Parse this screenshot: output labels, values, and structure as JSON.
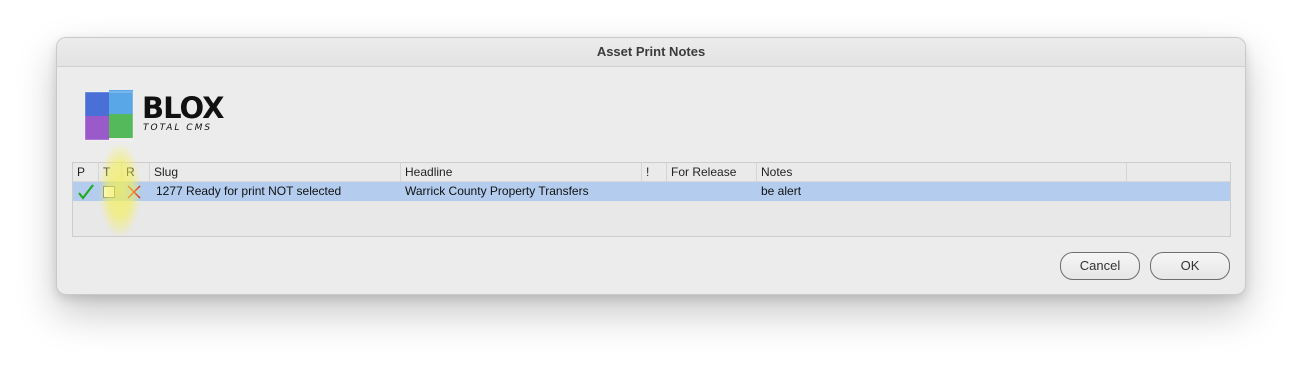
{
  "window": {
    "title": "Asset Print Notes"
  },
  "logo": {
    "word": "BLOX",
    "sub": "TOTAL CMS"
  },
  "table": {
    "columns": [
      "P",
      "T",
      "R",
      "Slug",
      "Headline",
      "!",
      "For Release",
      "Notes"
    ],
    "rows": [
      {
        "p_icon": "green-check-icon",
        "t_icon": "checkbox-icon",
        "r_icon": "red-x-icon",
        "slug": "1277 Ready for print NOT selected",
        "headline": "Warrick County Property Transfers",
        "priority": "",
        "for_release": "",
        "notes": "be alert"
      }
    ]
  },
  "buttons": {
    "cancel": "Cancel",
    "ok": "OK"
  },
  "colors": {
    "selected_row": "#b4cdef",
    "check": "#22aa22",
    "x": "#d02020",
    "highlight": "#f5f050"
  }
}
